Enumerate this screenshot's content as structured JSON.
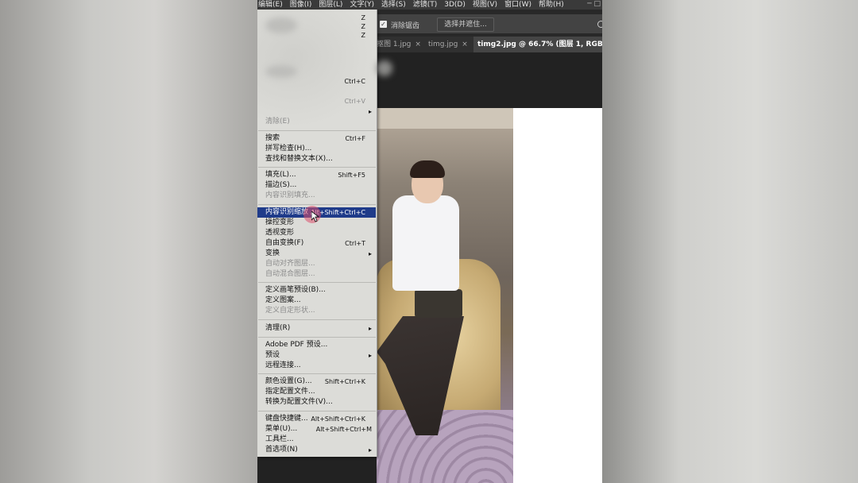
{
  "menubar": {
    "items": [
      "编辑(E)",
      "图像(I)",
      "图层(L)",
      "文字(Y)",
      "选择(S)",
      "滤镜(T)",
      "3D(D)",
      "视图(V)",
      "窗口(W)",
      "帮助(H)"
    ],
    "window_glyph": "─ □"
  },
  "options": {
    "antialias_label": "消除锯齿",
    "antialias_checked": true,
    "select_and_mask": "选择并遮住..."
  },
  "tabs": [
    {
      "label": "抠图 1.jpg",
      "close": "×",
      "active": false
    },
    {
      "label": "timg.jpg",
      "close": "×",
      "active": false
    },
    {
      "label": "timg2.jpg @ 66.7% (图层 1, RGB/8#) *",
      "close": "",
      "active": true
    }
  ],
  "menu": {
    "top_shortcuts": {
      "undo": "Z",
      "step_forward": "Z",
      "step_back": "Z"
    },
    "copy_shortcut": "Ctrl+C",
    "paste_shortcut": "Ctrl+V",
    "clear": "清除(E)",
    "items": [
      {
        "label": "搜索",
        "shortcut": "Ctrl+F"
      },
      {
        "label": "拼写检查(H)..."
      },
      {
        "label": "查找和替换文本(X)..."
      },
      {
        "label": "填充(L)...",
        "shortcut": "Shift+F5"
      },
      {
        "label": "描边(S)..."
      },
      {
        "label": "内容识别填充...",
        "disabled": true
      },
      {
        "label": "内容识别缩放",
        "shortcut": "Alt+Shift+Ctrl+C",
        "highlighted": true
      },
      {
        "label": "操控变形"
      },
      {
        "label": "透视变形"
      },
      {
        "label": "自由变换(F)",
        "shortcut": "Ctrl+T"
      },
      {
        "label": "变换",
        "submenu": "▸"
      },
      {
        "label": "自动对齐图层...",
        "disabled": true
      },
      {
        "label": "自动混合图层...",
        "disabled": true
      },
      {
        "label": "定义画笔预设(B)..."
      },
      {
        "label": "定义图案..."
      },
      {
        "label": "定义自定形状...",
        "disabled": true
      },
      {
        "label": "清理(R)",
        "submenu": "▸"
      },
      {
        "label": "Adobe PDF 预设..."
      },
      {
        "label": "预设",
        "submenu": "▸"
      },
      {
        "label": "远程连接..."
      },
      {
        "label": "颜色设置(G)...",
        "shortcut": "Shift+Ctrl+K"
      },
      {
        "label": "指定配置文件..."
      },
      {
        "label": "转换为配置文件(V)..."
      },
      {
        "label": "键盘快捷键...",
        "shortcut": "Alt+Shift+Ctrl+K"
      },
      {
        "label": "菜单(U)...",
        "shortcut": "Alt+Shift+Ctrl+M"
      },
      {
        "label": "工具栏..."
      },
      {
        "label": "首选项(N)",
        "submenu": "▸"
      }
    ],
    "paste_submenu_arrow": "▸"
  }
}
